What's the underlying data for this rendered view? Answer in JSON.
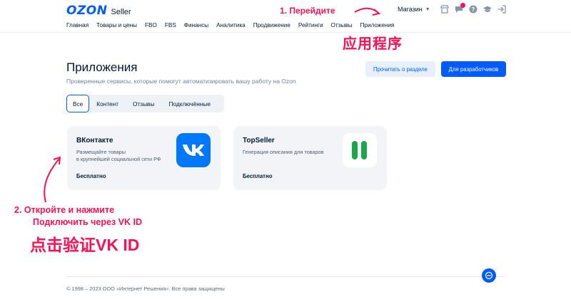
{
  "header": {
    "logo_brand": "OZON",
    "logo_product": "Seller",
    "shop_select": "Магазин",
    "icons": [
      "store-icon",
      "chat-icon",
      "help-icon",
      "academy-icon",
      "logout-icon"
    ]
  },
  "nav": {
    "items": [
      "Главная",
      "Товары и цены",
      "FBO",
      "FBS",
      "Финансы",
      "Аналитика",
      "Продвижение",
      "Рейтинги",
      "Отзывы",
      "Приложения"
    ]
  },
  "page": {
    "title": "Приложения",
    "subtitle": "Проверенные сервисы, которые помогут автоматизировать вашу работу на Ozon",
    "read_button": "Прочитать о разделе",
    "dev_button": "Для разработчиков"
  },
  "tabs": {
    "items": [
      "Все",
      "Контент",
      "Отзывы",
      "Подключённые"
    ],
    "active": "Все"
  },
  "apps": [
    {
      "name": "ВКонтакте",
      "desc_line1": "Размещайте товары",
      "desc_line2": "в крупнейшей социальной сети РФ",
      "price": "Бесплатно",
      "logo_text": "VK",
      "logo_color": "#0077ff"
    },
    {
      "name": "TopSeller",
      "desc_line1": "Генерация описания для товаров",
      "desc_line2": "",
      "price": "Бесплатно",
      "logo_color": "#1ba64b"
    }
  ],
  "annotations": {
    "step1": "1. Перейдите",
    "step1_cn": "应用程序",
    "step2_line1": "2. Откройте и нажмите",
    "step2_line2": "Подключить через VK ID",
    "step2_cn": "点击验证VK ID",
    "color": "#f91155"
  },
  "footer": {
    "copyright": "© 1998 – 2023 ООО «Интернет Решения». Все права защищены"
  },
  "colors": {
    "brand": "#005bff",
    "text": "#001a34",
    "muted": "#708499",
    "card_bg": "#f2f4f7"
  }
}
